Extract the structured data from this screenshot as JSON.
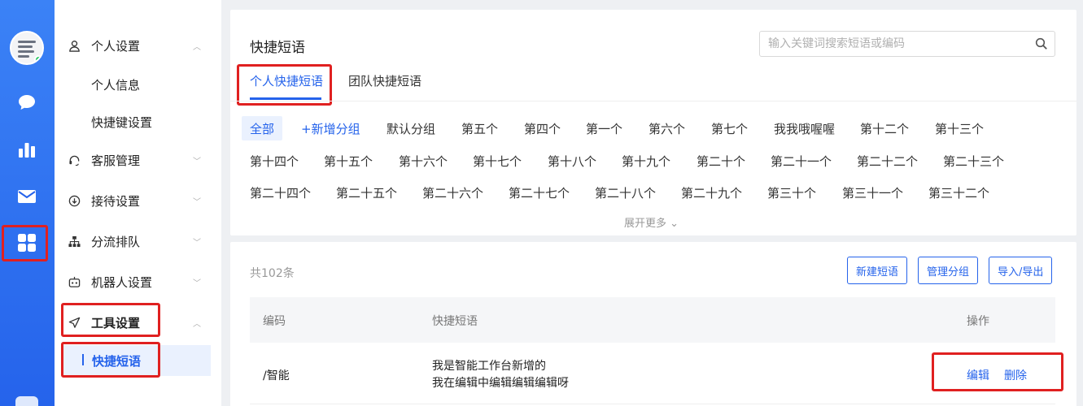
{
  "sidebar": {
    "groups": [
      {
        "label": "个人设置"
      },
      {
        "label": "客服管理"
      },
      {
        "label": "接待设置"
      },
      {
        "label": "分流排队"
      },
      {
        "label": "机器人设置"
      },
      {
        "label": "工具设置"
      }
    ],
    "personal_sub": [
      "个人信息",
      "快捷键设置"
    ],
    "tools_sub_active": "快捷短语"
  },
  "header": {
    "title": "快捷短语",
    "search_placeholder": "输入关键词搜索短语或编码"
  },
  "tabs": [
    "个人快捷短语",
    "团队快捷短语"
  ],
  "groups_filter": {
    "row1": [
      "全部",
      "+新增分组",
      "默认分组",
      "第五个",
      "第四个",
      "第一个",
      "第六个",
      "第七个",
      "我我哦喔喔",
      "第十二个",
      "第十三个"
    ],
    "row2": [
      "第十四个",
      "第十五个",
      "第十六个",
      "第十七个",
      "第十八个",
      "第十九个",
      "第二十个",
      "第二十一个",
      "第二十二个",
      "第二十三个"
    ],
    "row3": [
      "第二十四个",
      "第二十五个",
      "第二十六个",
      "第二十七个",
      "第二十八个",
      "第二十九个",
      "第三十个",
      "第三十一个",
      "第三十二个"
    ],
    "expand_label": "展开更多"
  },
  "list": {
    "count": "共102条",
    "buttons": [
      "新建短语",
      "管理分组",
      "导入/导出"
    ],
    "columns": [
      "编码",
      "快捷短语",
      "操作"
    ],
    "rows": [
      {
        "code": "/智能",
        "phrase_line1": "我是智能工作台新增的",
        "phrase_line2": "我在编辑中编辑编辑编辑呀",
        "edit": "编辑",
        "delete": "删除"
      }
    ]
  },
  "colors": {
    "accent": "#2563eb",
    "highlight_box": "#e02020"
  }
}
